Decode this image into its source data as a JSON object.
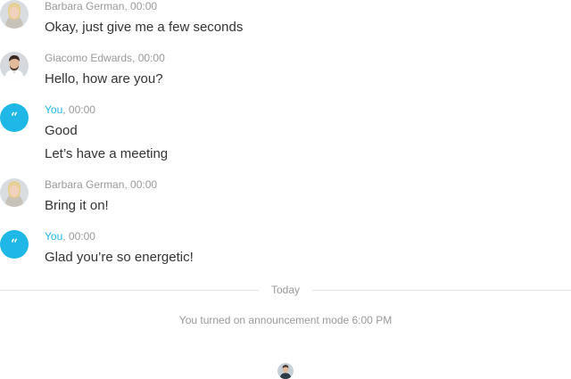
{
  "messages": [
    {
      "sender": "Barbara German",
      "separator": ", ",
      "time": "00:00",
      "avatar": "barbara-avatar",
      "lines": [
        "Okay, just give me a few seconds"
      ]
    },
    {
      "sender": "Giacomo Edwards",
      "separator": ", ",
      "time": "00:00",
      "avatar": "giacomo-avatar",
      "lines": [
        "Hello, how are you?"
      ]
    },
    {
      "sender": "You",
      "separator": ", ",
      "time": "00:00",
      "avatar": "you-quote-avatar",
      "avatar_glyph": "“",
      "lines": [
        "Good",
        "Let’s have a meeting"
      ]
    },
    {
      "sender": "Barbara German",
      "separator": ", ",
      "time": "00:00",
      "avatar": "barbara-avatar",
      "lines": [
        "Bring it on!"
      ]
    },
    {
      "sender": "You",
      "separator": ", ",
      "time": "00:00",
      "avatar": "you-quote-avatar",
      "avatar_glyph": "“",
      "lines": [
        "Glad you’re so energetic!"
      ]
    }
  ],
  "divider": {
    "label": "Today"
  },
  "system_message": "You turned on announcement mode 6:00 PM",
  "colors": {
    "accent": "#1fb8e6",
    "meta_text": "#999999",
    "body_text": "#333333",
    "divider": "#e3e3e3"
  }
}
